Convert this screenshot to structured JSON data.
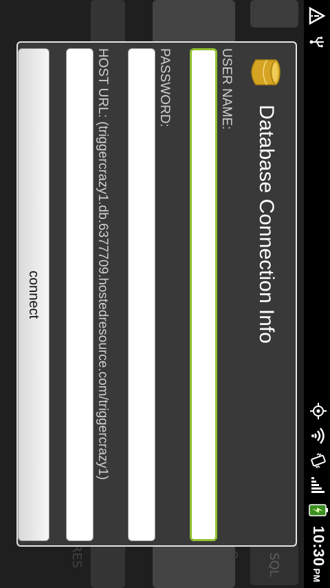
{
  "status_bar": {
    "time": "10:30",
    "ampm": "PM",
    "icons_left": [
      "warning-icon",
      "usb-icon"
    ],
    "icons_right": [
      "gps-icon",
      "wifi-icon",
      "vibrate-icon",
      "signal-icon",
      "battery-icon"
    ]
  },
  "background_app": {
    "tabs": [
      "",
      "",
      "",
      "SQL"
    ],
    "side_text": "RES",
    "button_partial": "e"
  },
  "dialog": {
    "title": "Database Connection Info",
    "icon": "database-icon",
    "fields": [
      {
        "label": "USER NAME:",
        "value": ""
      },
      {
        "label": "PASSWORD:",
        "value": ""
      },
      {
        "label": "HOST URL: (triggercrazy1.db.6377709.hostedresource.com/triggercrazy1)",
        "value": ""
      }
    ],
    "connect_label": "connect"
  },
  "colors": {
    "focus_border": "#8fbf2f",
    "dialog_bg": "#393939",
    "icon_gold": "#e0b430"
  }
}
